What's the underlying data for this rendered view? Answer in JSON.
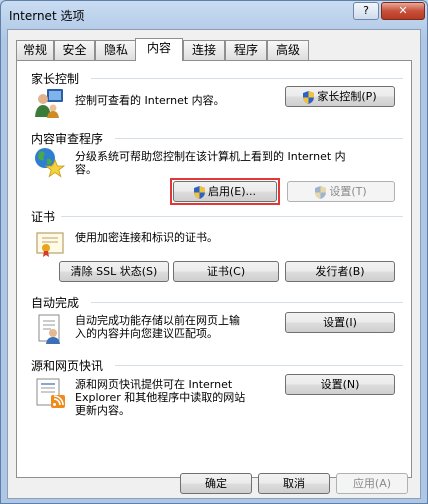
{
  "window": {
    "title": "Internet 选项",
    "help_glyph": "?",
    "close_glyph": "✕"
  },
  "tabs": [
    {
      "label": "常规"
    },
    {
      "label": "安全"
    },
    {
      "label": "隐私"
    },
    {
      "label": "内容",
      "active": true
    },
    {
      "label": "连接"
    },
    {
      "label": "程序"
    },
    {
      "label": "高级"
    }
  ],
  "parental": {
    "title": "家长控制",
    "description": "控制可查看的 Internet 内容。",
    "button": "家长控制(P)"
  },
  "advisor": {
    "title": "内容审查程序",
    "description_line1": "分级系统可帮助您控制在该计算机上看到的 Internet 内",
    "description_line2": "容。",
    "enable_button": "启用(E)...",
    "settings_button": "设置(T)"
  },
  "certificates": {
    "title": "证书",
    "description": "使用加密连接和标识的证书。",
    "clear_ssl_button": "清除 SSL 状态(S)",
    "certificates_button": "证书(C)",
    "publishers_button": "发行者(B)"
  },
  "autocomplete": {
    "title": "自动完成",
    "description_line1": "自动完成功能存储以前在网页上输",
    "description_line2": "入的内容并向您建议匹配项。",
    "settings_button": "设置(I)"
  },
  "feeds": {
    "title": "源和网页快讯",
    "description_line1": "源和网页快讯提供可在 Internet",
    "description_line2": "Explorer 和其他程序中读取的网站",
    "description_line3": "更新内容。",
    "settings_button": "设置(N)"
  },
  "footer": {
    "ok": "确定",
    "cancel": "取消",
    "apply": "应用(A)"
  },
  "colors": {
    "highlight": "#e03838"
  }
}
